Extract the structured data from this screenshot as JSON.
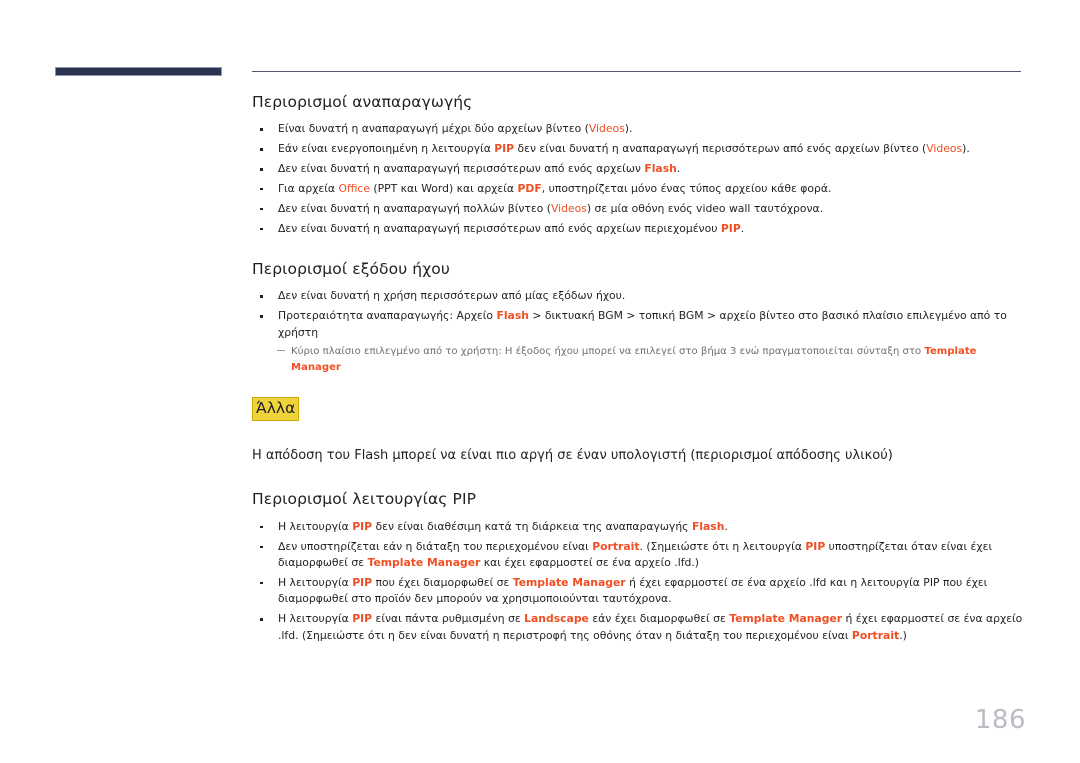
{
  "page": {
    "number": "186"
  },
  "sections": {
    "playback_limits": {
      "title": "Περιορισμοί αναπαραγωγής",
      "bullets": [
        [
          {
            "t": "Είναι δυνατή η αναπαραγωγή μέχρι δύο αρχείων βίντεο ("
          },
          {
            "t": "Videos",
            "s": "acc"
          },
          {
            "t": ")."
          }
        ],
        [
          {
            "t": "Εάν είναι ενεργοποιημένη η λειτουργία "
          },
          {
            "t": "PIP",
            "s": "acc-b"
          },
          {
            "t": " δεν είναι δυνατή η αναπαραγωγή περισσότερων από ενός αρχείων βίντεο ("
          },
          {
            "t": "Videos",
            "s": "acc"
          },
          {
            "t": ")."
          }
        ],
        [
          {
            "t": "Δεν είναι δυνατή η αναπαραγωγή περισσότερων από ενός αρχείων "
          },
          {
            "t": "Flash",
            "s": "acc-b"
          },
          {
            "t": "."
          }
        ],
        [
          {
            "t": "Για αρχεία "
          },
          {
            "t": "Office",
            "s": "acc"
          },
          {
            "t": " (PPT και Word) και αρχεία "
          },
          {
            "t": "PDF",
            "s": "acc-b"
          },
          {
            "t": ", υποστηρίζεται μόνο ένας τύπος αρχείου κάθε φορά."
          }
        ],
        [
          {
            "t": "Δεν είναι δυνατή η αναπαραγωγή πολλών βίντεο ("
          },
          {
            "t": "Videos",
            "s": "acc"
          },
          {
            "t": ") σε μία οθόνη ενός video wall ταυτόχρονα."
          }
        ],
        [
          {
            "t": "Δεν είναι δυνατή η αναπαραγωγή περισσότερων από ενός αρχείων περιεχομένου "
          },
          {
            "t": "PIP",
            "s": "acc-b"
          },
          {
            "t": "."
          }
        ]
      ]
    },
    "audio_output_limits": {
      "title": "Περιορισμοί εξόδου ήχου",
      "bullets": [
        [
          {
            "t": "Δεν είναι δυνατή η χρήση περισσότερων από μίας εξόδων ήχου."
          }
        ],
        [
          {
            "t": "Προτεραιότητα αναπαραγωγής: Αρχείο "
          },
          {
            "t": "Flash",
            "s": "acc-b"
          },
          {
            "t": " > δικτυακή BGM > τοπική BGM > αρχείο βίντεο στο βασικό πλαίσιο επιλεγμένο από το χρήστη"
          }
        ]
      ],
      "subnote": [
        {
          "t": "Κύριο πλαίσιο επιλεγμένο από το χρήστη: Η έξοδος ήχου μπορεί να επιλεγεί στο βήμα 3 ενώ πραγματοποιείται σύνταξη στο "
        },
        {
          "t": "Template Manager",
          "s": "acc-b"
        }
      ]
    },
    "other": {
      "heading": "Άλλα",
      "paragraph": "Η απόδοση του Flash μπορεί να είναι πιο αργή σε έναν υπολογιστή (περιορισμοί απόδοσης υλικού)"
    },
    "pip_limits": {
      "title": "Περιορισμοί λειτουργίας PIP",
      "bullets": [
        [
          {
            "t": "Η λειτουργία "
          },
          {
            "t": "PIP",
            "s": "acc-b"
          },
          {
            "t": " δεν είναι διαθέσιμη κατά τη διάρκεια της αναπαραγωγής "
          },
          {
            "t": "Flash",
            "s": "acc-b"
          },
          {
            "t": "."
          }
        ],
        [
          {
            "t": "Δεν υποστηρίζεται εάν η διάταξη του περιεχομένου είναι "
          },
          {
            "t": "Portrait",
            "s": "acc-b"
          },
          {
            "t": ".  (Σημειώστε ότι η λειτουργία "
          },
          {
            "t": "PIP",
            "s": "acc-b"
          },
          {
            "t": " υποστηρίζεται όταν είναι έχει διαμορφωθεί σε "
          },
          {
            "t": "Template Manager",
            "s": "acc-b"
          },
          {
            "t": " και έχει εφαρμοστεί σε ένα αρχείο .lfd.)"
          }
        ],
        [
          {
            "t": "Η λειτουργία "
          },
          {
            "t": "PIP",
            "s": "acc-b"
          },
          {
            "t": " που έχει διαμορφωθεί σε "
          },
          {
            "t": "Template Manager",
            "s": "acc-b"
          },
          {
            "t": " ή έχει εφαρμοστεί σε ένα αρχείο .lfd και η λειτουργία PIP που έχει διαμορφωθεί στο προϊόν δεν μπορούν να χρησιμοποιούνται ταυτόχρονα."
          }
        ],
        [
          {
            "t": "Η λειτουργία "
          },
          {
            "t": "PIP",
            "s": "acc-b"
          },
          {
            "t": " είναι πάντα ρυθμισμένη σε "
          },
          {
            "t": "Landscape",
            "s": "acc-b"
          },
          {
            "t": " εάν έχει διαμορφωθεί σε "
          },
          {
            "t": "Template Manager",
            "s": "acc-b"
          },
          {
            "t": " ή έχει εφαρμοστεί σε ένα αρχείο .lfd. (Σημειώστε ότι η δεν είναι δυνατή η περιστροφή της οθόνης όταν η διάταξη του περιεχομένου είναι "
          },
          {
            "t": "Portrait",
            "s": "acc-b"
          },
          {
            "t": ".)"
          }
        ]
      ]
    }
  },
  "colors": {
    "accent": "#f04e23",
    "header_bar": "#2b3350",
    "highlight": "#efd33b",
    "page_number": "#b9bcc2"
  }
}
